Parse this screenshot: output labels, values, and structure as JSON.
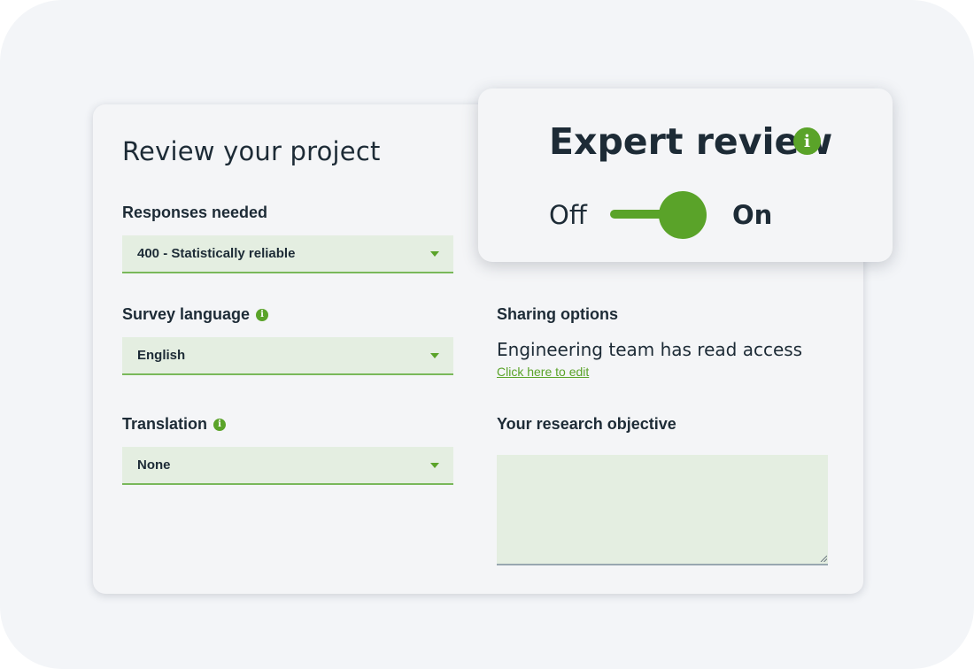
{
  "page": {
    "title": "Review your project"
  },
  "responses": {
    "label": "Responses needed",
    "selected": "400 - Statistically reliable"
  },
  "language": {
    "label": "Survey language",
    "selected": "English"
  },
  "translation": {
    "label": "Translation",
    "selected": "None"
  },
  "sharing": {
    "label": "Sharing options",
    "text": "Engineering team has read access",
    "edit_link": "Click here to edit"
  },
  "objective": {
    "label": "Your research objective",
    "value": ""
  },
  "expert_review": {
    "title": "Expert review",
    "off_label": "Off",
    "on_label": "On",
    "enabled": true
  },
  "icons": {
    "info": "info-icon",
    "dropdown": "chevron-down-icon"
  },
  "colors": {
    "accent": "#5aa329",
    "field_bg": "#e4eee1",
    "text": "#1d2b36",
    "card_bg": "#f4f5f7"
  }
}
